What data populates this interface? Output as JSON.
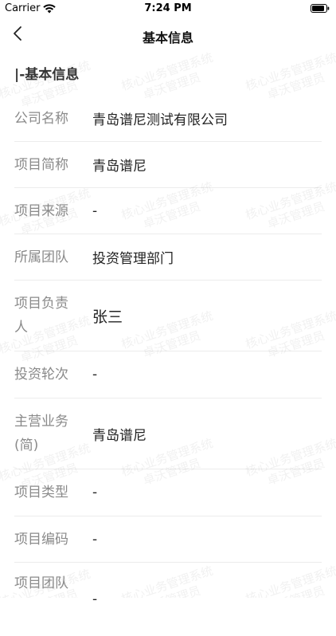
{
  "status_bar": {
    "carrier": "Carrier",
    "time": "7:24 PM"
  },
  "nav": {
    "title": "基本信息",
    "back_icon": "chevron-left-icon"
  },
  "section": {
    "title": "|-基本信息"
  },
  "rows": [
    {
      "label": "公司名称",
      "value": "青岛谱尼测试有限公司"
    },
    {
      "label": "项目简称",
      "value": "青岛谱尼"
    },
    {
      "label": "项目来源",
      "value": "-"
    },
    {
      "label": "所属团队",
      "value": "投资管理部门"
    },
    {
      "label": "项目负责人",
      "value": "张三"
    },
    {
      "label": "投资轮次",
      "value": "-"
    },
    {
      "label": "主营业务(简)",
      "value": "青岛谱尼"
    },
    {
      "label": "项目类型",
      "value": "-"
    },
    {
      "label": "项目编码",
      "value": "-"
    },
    {
      "label": "项目团队",
      "value": "-"
    }
  ],
  "watermark": {
    "line1": "核心业务管理系统",
    "line2": "卓沃管理员"
  }
}
